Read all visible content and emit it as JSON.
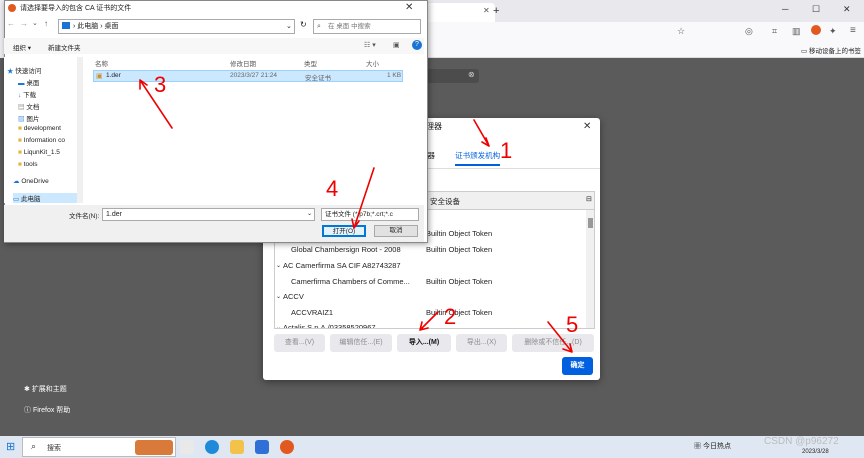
{
  "firefox": {
    "new_tab_glyph": "+",
    "sidebar_items": [
      "扩展和主题",
      "Firefox 帮助"
    ],
    "bookmark_label": "移动设备上的书签"
  },
  "file_dialog": {
    "title": "请选择要导入的包含 CA 证书的文件",
    "path": [
      "此电脑",
      "桌面"
    ],
    "search_placeholder": "在 桌面 中搜索",
    "organize": "组织 ▾",
    "new_folder": "新建文件夹",
    "nav_items": [
      {
        "label": "快速访问",
        "icon": "star-icon"
      },
      {
        "label": "桌面",
        "icon": "desktop-icon"
      },
      {
        "label": "下载",
        "icon": "download-icon"
      },
      {
        "label": "文档",
        "icon": "document-icon"
      },
      {
        "label": "图片",
        "icon": "picture-icon"
      },
      {
        "label": "development",
        "icon": "folder-icon"
      },
      {
        "label": "Information co",
        "icon": "folder-icon"
      },
      {
        "label": "LiqunKit_1.5",
        "icon": "folder-icon"
      },
      {
        "label": "tools",
        "icon": "folder-icon"
      },
      {
        "label": "OneDrive",
        "icon": "cloud-icon"
      },
      {
        "label": "此电脑",
        "icon": "computer-icon"
      }
    ],
    "columns": [
      "名称",
      "修改日期",
      "类型",
      "大小"
    ],
    "files": [
      {
        "name": "1.der",
        "modified": "2023/3/27 21:24",
        "type": "安全证书",
        "size": "1 KB"
      }
    ],
    "filename_label": "文件名(N):",
    "filename_value": "1.der",
    "filetype": "证书文件 (*.p7b;*.crt;*.c",
    "open_button": "打开(O)",
    "cancel_button": "取消"
  },
  "cert_manager": {
    "title": "理器",
    "tabs": [
      "务器",
      "证书颁发机构"
    ],
    "header_col2": "安全设备",
    "rows": [
      {
        "kind": "item",
        "name": "",
        "device": "Builtin Object Token"
      },
      {
        "kind": "item",
        "name": "Global Chambersign Root - 2008",
        "device": "Builtin Object Token"
      },
      {
        "kind": "group",
        "name": "AC Camerfirma SA CIF A82743287",
        "device": ""
      },
      {
        "kind": "item",
        "name": "Camerfirma Chambers of Comme...",
        "device": "Builtin Object Token"
      },
      {
        "kind": "group",
        "name": "ACCV",
        "device": ""
      },
      {
        "kind": "item",
        "name": "ACCVRAIZ1",
        "device": "Builtin Object Token"
      },
      {
        "kind": "group",
        "name": "Actalis S.p.A./03358520967",
        "device": ""
      }
    ],
    "buttons": [
      "查看...(V)",
      "编辑信任...(E)",
      "导入...(M)",
      "导出...(X)",
      "删除或不信任...(D)"
    ],
    "ok_button": "确定"
  },
  "annotations": [
    "1",
    "2",
    "3",
    "4",
    "5"
  ],
  "taskbar": {
    "search_label": "搜索",
    "news_label": "今日热点",
    "time": "2023/3/28",
    "watermark": "CSDN @p96272"
  }
}
